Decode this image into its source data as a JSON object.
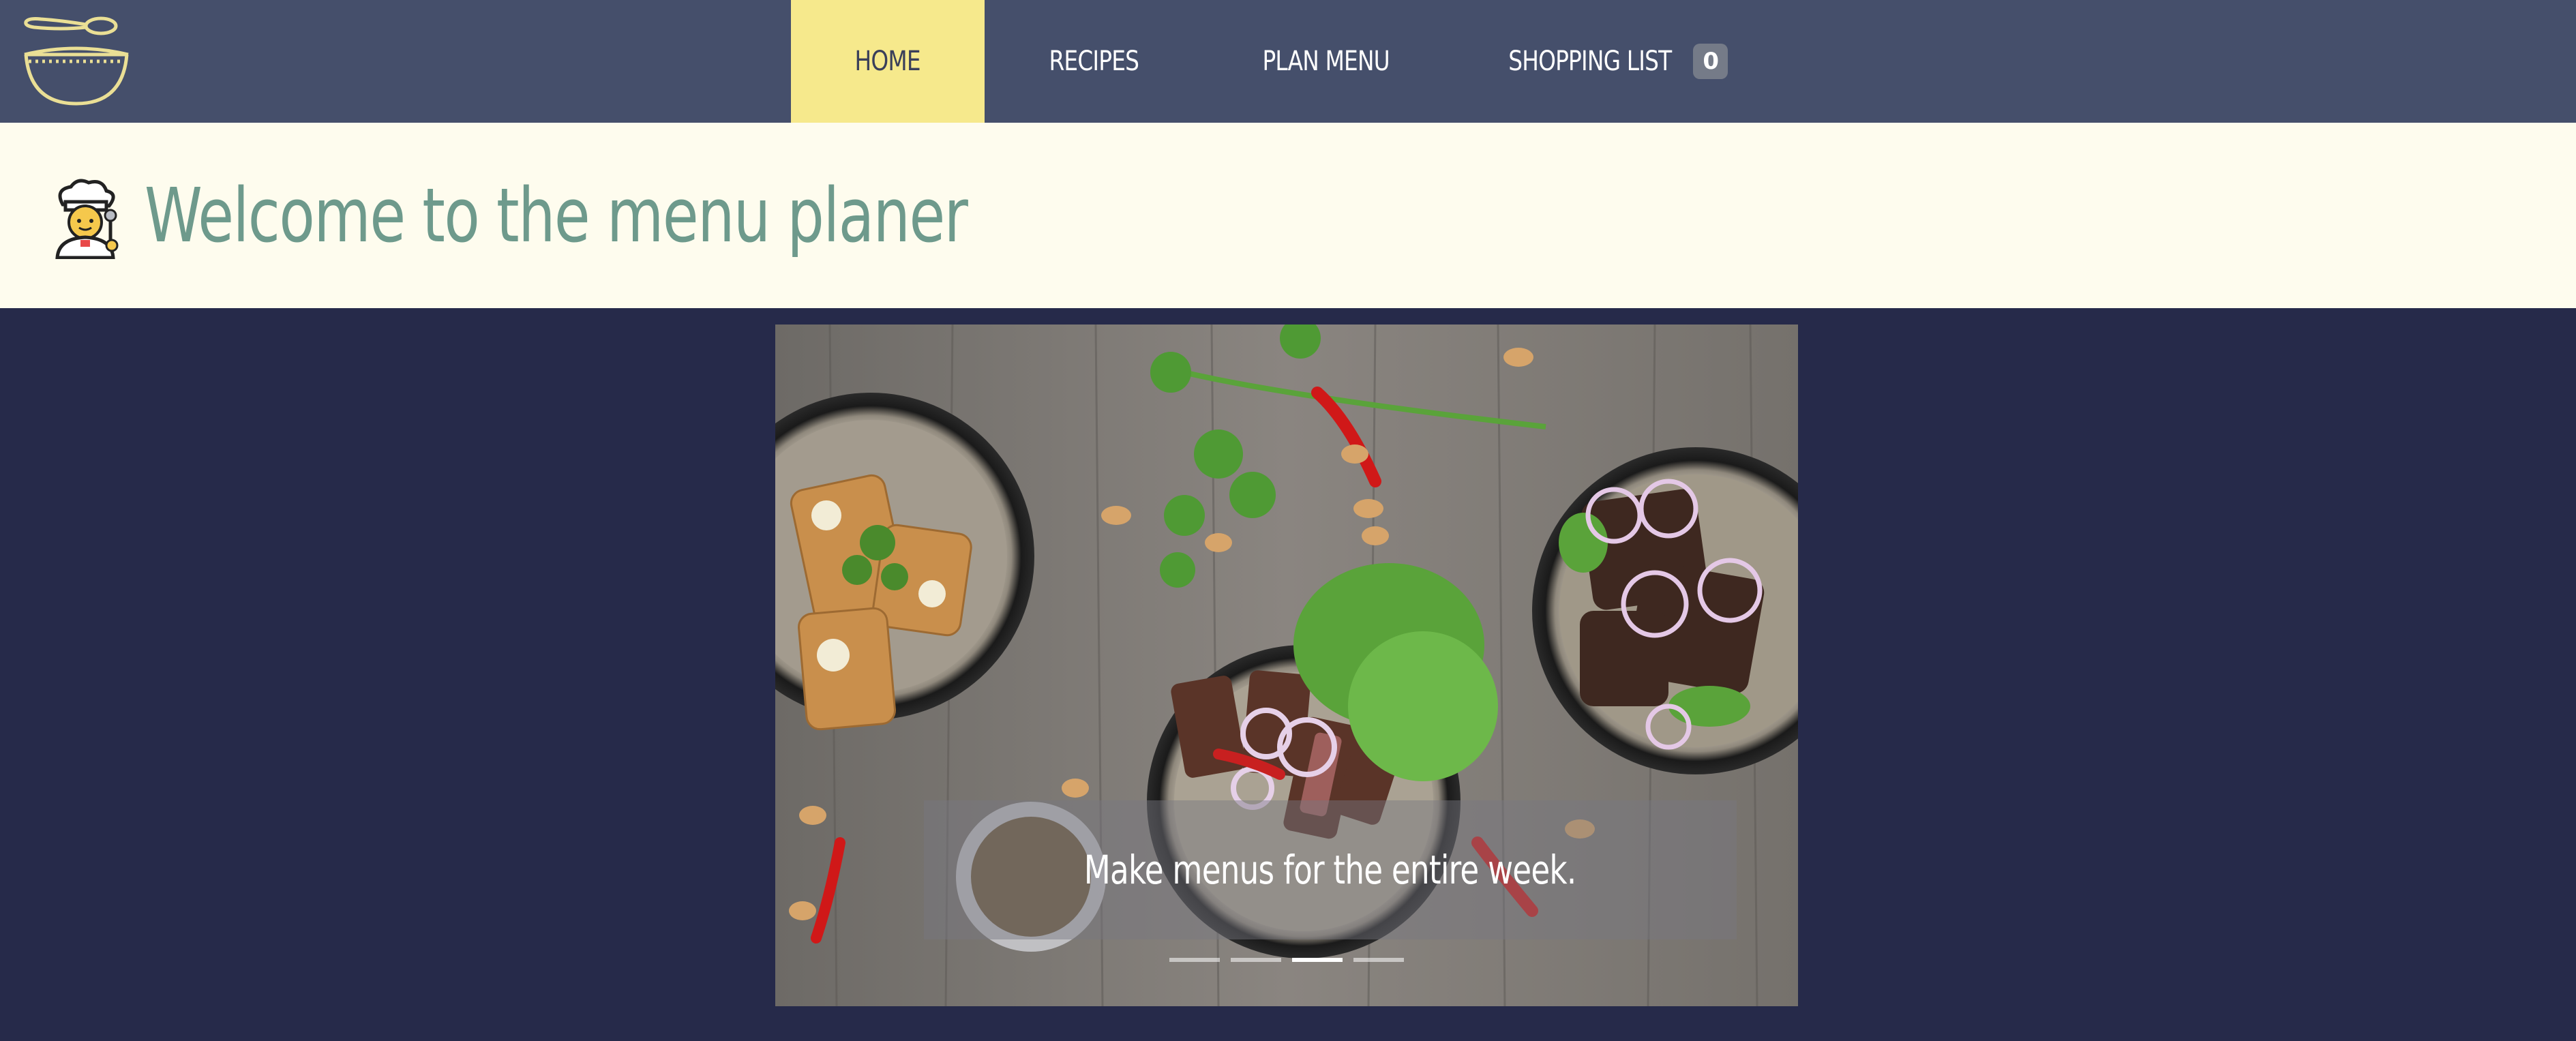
{
  "navbar": {
    "logo_icon": "pot-and-spoon-icon",
    "items": [
      {
        "label": "HOME",
        "active": true
      },
      {
        "label": "RECIPES",
        "active": false
      },
      {
        "label": "PLAN MENU",
        "active": false
      },
      {
        "label": "SHOPPING LIST",
        "active": false,
        "badge": "0"
      }
    ],
    "colors": {
      "background": "#454f6b",
      "active": "#f6e98c"
    }
  },
  "header": {
    "icon": "chef-emoji-icon",
    "title": "Welcome to the menu planer",
    "colors": {
      "background": "#fefcee",
      "title": "#6e9a8c"
    }
  },
  "carousel": {
    "caption": "Make menus for the entire week.",
    "slide_count": 4,
    "active_slide": 3
  },
  "page": {
    "background": "#262a4a"
  }
}
